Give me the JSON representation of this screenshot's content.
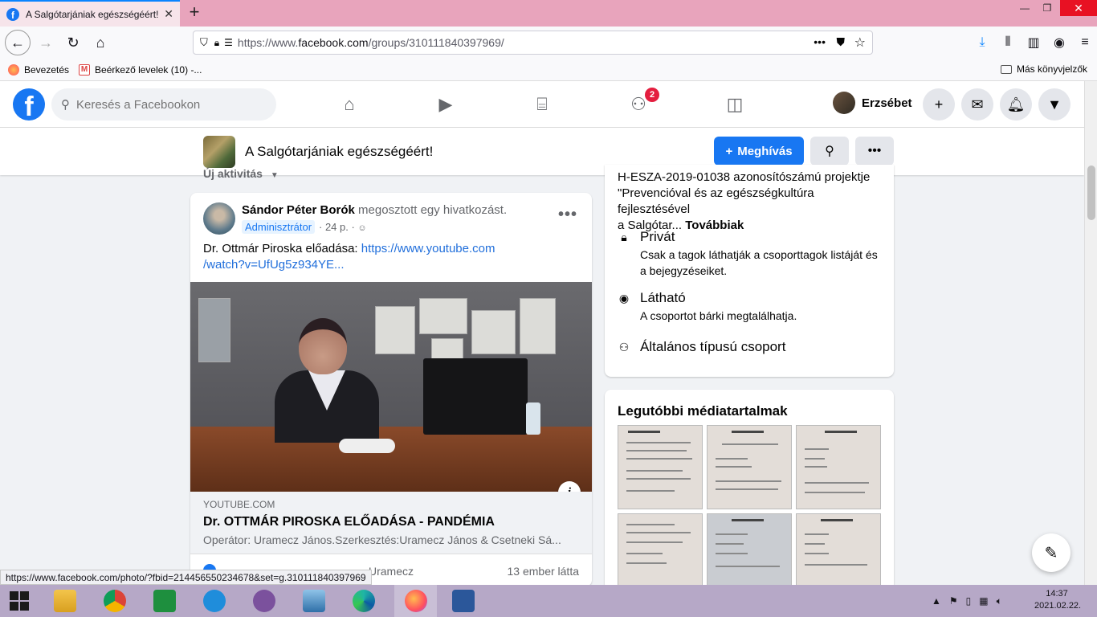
{
  "browser": {
    "tab_title": "A Salgótarjániak egészségéért! | Fa",
    "url_prefix": "https://www.",
    "url_domain": "facebook.com",
    "url_path": "/groups/310111840397969/",
    "bookmarks": [
      "Bevezetés",
      "Beérkező levelek (10) -..."
    ],
    "other_bookmarks": "Más könyvjelzők",
    "status_url": "https://www.facebook.com/photo/?fbid=214456550234678&set=g.310111840397969"
  },
  "fb": {
    "search_placeholder": "Keresés a Facebookon",
    "groups_badge": "2",
    "user_name": "Erzsébet"
  },
  "group": {
    "name": "A Salgótarjániak egészségéért!",
    "invite_label": "Meghívás"
  },
  "feed": {
    "activity_label": "Új aktivitás"
  },
  "post": {
    "author": "Sándor Péter Borók",
    "action": "megosztott egy hivatkozást.",
    "role": "Adminisztrátor",
    "time": "· 24 p. ·",
    "text": "Dr. Ottmár Piroska előadása:",
    "link_text_1": "https://www.youtube.com",
    "link_text_2": "/watch?v=UfUg5z934YE...",
    "link_domain": "YOUTUBE.COM",
    "link_title": "Dr. OTTMÁR PIROSKA ELŐADÁSA - PANDÉMIA",
    "link_desc": "Operátor: Uramecz János.Szerkesztés:Uramecz János & Csetneki Sá...",
    "liker": "Uramecz",
    "seen_count": "13 ember látta"
  },
  "about": {
    "desc_line1": "H-ESZA-2019-01038 azonosítószámú projektje",
    "desc_line2": "\"Prevencióval és az egészségkultúra fejlesztésével",
    "desc_line3": "a Salgótar...",
    "desc_more": "Továbbiak",
    "private_title": "Privát",
    "private_desc": "Csak a tagok láthatják a csoporttagok listáját és a bejegyzéseiket.",
    "visible_title": "Látható",
    "visible_desc": "A csoportot bárki megtalálhatja.",
    "type_title": "Általános típusú csoport"
  },
  "media": {
    "title": "Legutóbbi médiatartalmak"
  },
  "taskbar": {
    "time": "14:37",
    "date": "2021.02.22."
  },
  "colors": {
    "fb_blue": "#1877f2",
    "tab_strip": "#e8a4bc",
    "taskbar": "#b6a8c7"
  }
}
